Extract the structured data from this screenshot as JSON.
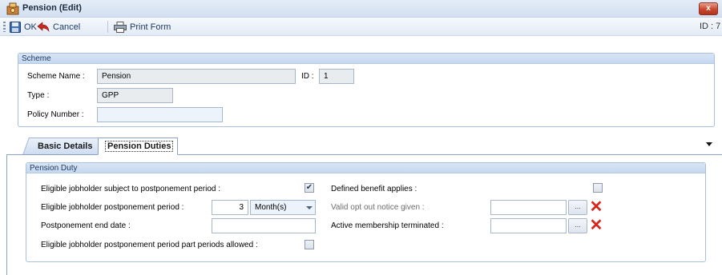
{
  "window": {
    "title": "Pension (Edit)",
    "close_label": "x"
  },
  "toolbar": {
    "ok": "OK",
    "cancel": "Cancel",
    "print_form": "Print Form",
    "id_label": "ID : 7"
  },
  "scheme": {
    "group_title": "Scheme",
    "scheme_name_label": "Scheme Name :",
    "scheme_name_value": "Pension",
    "id_label": "ID :",
    "id_value": "1",
    "type_label": "Type :",
    "type_value": "GPP",
    "policy_number_label": "Policy Number :",
    "policy_number_value": ""
  },
  "tabs": [
    {
      "label": "Basic Details"
    },
    {
      "label": "Pension Duties"
    }
  ],
  "pension_duty": {
    "group_title": "Pension Duty",
    "subject_postponement_label": "Eligible jobholder subject to postponement period :",
    "subject_postponement_checked": true,
    "postponement_period_label": "Eligible jobholder postponement period :",
    "postponement_period_value": "3",
    "postponement_period_unit": "Month(s)",
    "postponement_end_label": "Postponement end date :",
    "postponement_end_value": "",
    "part_periods_label": "Eligible jobholder postponement period part periods allowed :",
    "part_periods_checked": false,
    "defined_benefit_label": "Defined benefit applies :",
    "defined_benefit_checked": false,
    "opt_out_label": "Valid opt out notice given :",
    "opt_out_value": "",
    "membership_terminated_label": "Active membership terminated :",
    "membership_terminated_value": "",
    "spin_glyph": "...",
    "clear_glyph": "✕"
  },
  "colors": {
    "accent": "#1e3a63",
    "group_header": "#c6d8ef",
    "clear_red": "#d8241b"
  }
}
